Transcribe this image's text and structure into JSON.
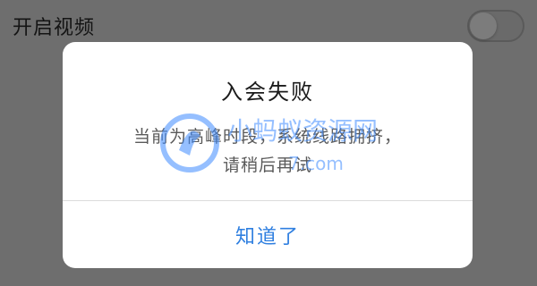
{
  "background": {
    "setting_label": "开启视频",
    "toggle_on": false
  },
  "dialog": {
    "title": "入会失败",
    "message_line1": "当前为高峰时段，系统线路拥挤，",
    "message_line2": "请稍后再试",
    "action_label": "知道了",
    "action_color": "#2f7fe0"
  },
  "watermark": {
    "name": "小蚂蚁资源网",
    "domain": "7.com",
    "color": "#3f8cff"
  }
}
